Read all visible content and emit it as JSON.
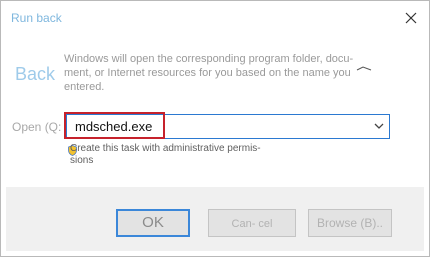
{
  "window": {
    "title": "Run back",
    "close_icon": "close-icon"
  },
  "body": {
    "back_text": "Back",
    "description": "Windows will open the corresponding program folder, docu- ment, or Internet resources for you based on the name you entered."
  },
  "open_field": {
    "label": "Open (Q:",
    "value": "mdsched.exe",
    "arrow_icon": "chevron-down-icon"
  },
  "admin": {
    "text": "Create this task with administrative permis- sions",
    "icon": "shield-icon"
  },
  "buttons": {
    "ok": "OK",
    "cancel": "Can- cel",
    "browse": "Browse (B).."
  },
  "colors": {
    "accent": "#2b79d1",
    "highlight": "#c6222c"
  }
}
